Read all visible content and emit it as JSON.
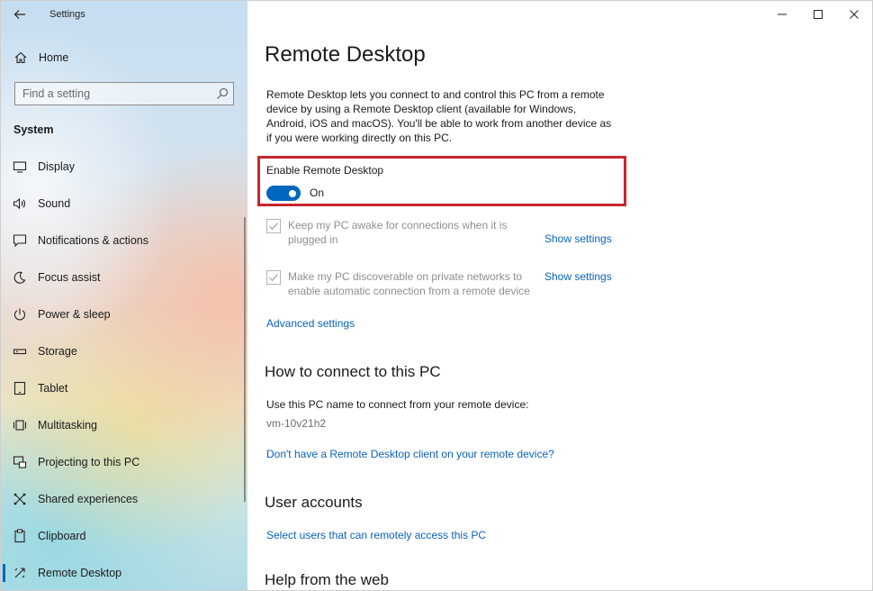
{
  "window": {
    "app_title": "Settings",
    "caption_buttons": [
      "minimize",
      "maximize",
      "close"
    ]
  },
  "sidebar": {
    "home_label": "Home",
    "search_placeholder": "Find a setting",
    "section": "System",
    "items": [
      {
        "label": "Display",
        "icon": "display-icon"
      },
      {
        "label": "Sound",
        "icon": "sound-icon"
      },
      {
        "label": "Notifications & actions",
        "icon": "notifications-icon"
      },
      {
        "label": "Focus assist",
        "icon": "focus-assist-icon"
      },
      {
        "label": "Power & sleep",
        "icon": "power-icon"
      },
      {
        "label": "Storage",
        "icon": "storage-icon"
      },
      {
        "label": "Tablet",
        "icon": "tablet-icon"
      },
      {
        "label": "Multitasking",
        "icon": "multitasking-icon"
      },
      {
        "label": "Projecting to this PC",
        "icon": "projecting-icon"
      },
      {
        "label": "Shared experiences",
        "icon": "shared-experiences-icon"
      },
      {
        "label": "Clipboard",
        "icon": "clipboard-icon"
      },
      {
        "label": "Remote Desktop",
        "icon": "remote-desktop-icon",
        "active": true
      }
    ]
  },
  "main": {
    "title": "Remote Desktop",
    "description": "Remote Desktop lets you connect to and control this PC from a remote device by using a Remote Desktop client (available for Windows, Android, iOS and macOS). You'll be able to work from another device as if you were working directly on this PC.",
    "toggle": {
      "label": "Enable Remote Desktop",
      "state": "On",
      "checked": true
    },
    "checkboxes": [
      {
        "text": "Keep my PC awake for connections when it is plugged in",
        "link": "Show settings",
        "checked": true,
        "disabled": true
      },
      {
        "text": "Make my PC discoverable on private networks to enable automatic connection from a remote device",
        "link": "Show settings",
        "checked": true,
        "disabled": true
      }
    ],
    "advanced_link": "Advanced settings",
    "connect_heading": "How to connect to this PC",
    "connect_text": "Use this PC name to connect from your remote device:",
    "pc_name": "vm-10v21h2",
    "client_link": "Don't have a Remote Desktop client on your remote device?",
    "accounts_heading": "User accounts",
    "accounts_link": "Select users that can remotely access this PC",
    "help_heading": "Help from the web"
  },
  "colors": {
    "accent": "#0067c0",
    "link": "#0a62b8",
    "highlight_border": "#c8262e",
    "disabled_text": "#8f8f8f"
  }
}
